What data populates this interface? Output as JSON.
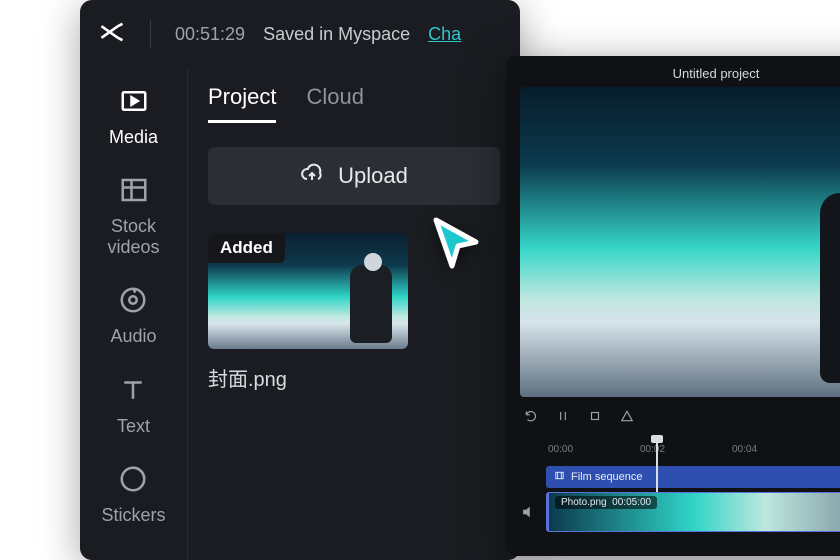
{
  "header": {
    "timestamp": "00:51:29",
    "saved_text": "Saved in Myspace",
    "autosave_link": "Cha"
  },
  "sidebar": {
    "items": [
      {
        "label": "Media"
      },
      {
        "label": "Stock\nvideos"
      },
      {
        "label": "Audio"
      },
      {
        "label": "Text"
      },
      {
        "label": "Stickers"
      }
    ]
  },
  "panel": {
    "tabs": {
      "project": "Project",
      "cloud": "Cloud"
    },
    "upload_label": "Upload",
    "media": {
      "badge": "Added",
      "filename": "封面.png"
    }
  },
  "preview": {
    "title": "Untitled project",
    "ruler": {
      "t0": "00:00",
      "t1": "00:02",
      "t2": "00:04"
    },
    "sequence_label": "Film sequence",
    "clip": {
      "name": "Photo.png",
      "duration": "00:05:00"
    }
  }
}
